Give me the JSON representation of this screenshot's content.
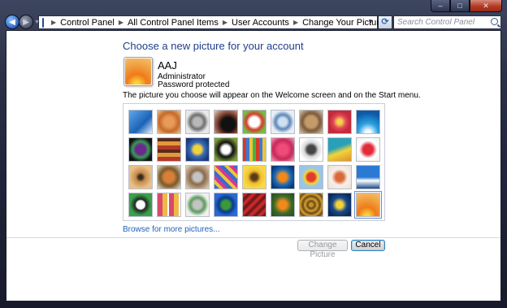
{
  "window": {
    "controls": [
      "–",
      "□",
      "✕"
    ]
  },
  "address_bar": {
    "crumbs": [
      "Control Panel",
      "All Control Panel Items",
      "User Accounts",
      "Change Your Picture"
    ],
    "search_placeholder": "Search Control Panel"
  },
  "page": {
    "heading": "Choose a new picture for your account",
    "account": {
      "name": "AAJ",
      "role": "Administrator",
      "status": "Password protected"
    },
    "description": "The picture you choose will appear on the Welcome screen and on the Start menu.",
    "browse_link": "Browse for more pictures...",
    "buttons": {
      "change": "Change Picture",
      "cancel": "Cancel"
    }
  },
  "pictures": [
    {
      "icon": "ferris-wheel",
      "bg": "linear-gradient(135deg,#5fa8e8,#1c63b7 60%,#e6eef8)"
    },
    {
      "icon": "starfish",
      "bg": "radial-gradient(circle,#e89a58 30%,#c46a2a 60%,#f0c48e)"
    },
    {
      "icon": "robot-toy",
      "bg": "radial-gradient(circle,#b8b8b8 25%,#6e6e6e 45%,#e8e8e8 70%)"
    },
    {
      "icon": "record-player",
      "bg": "radial-gradient(circle at 60% 60%,#111 35%,#7a3a2a 55%,#e1d3c0)"
    },
    {
      "icon": "lucky-cat",
      "bg": "radial-gradient(circle,#fff 30%,#d43a2a 50%,#7ab84a 75%)"
    },
    {
      "icon": "globe",
      "bg": "radial-gradient(circle,#cfe0f0 25%,#5a87b8 45%,#e8eef4 70%)"
    },
    {
      "icon": "cat",
      "bg": "radial-gradient(circle,#c49a6a 35%,#7a5a3a 55%,#d8c8b0)"
    },
    {
      "icon": "flower",
      "bg": "radial-gradient(circle,#f4d24a 15%,#e2455a 40%,#c42a3a 65%)"
    },
    {
      "icon": "ferris-wheel-blue",
      "bg": "radial-gradient(circle at 50% 100%,#ffffff 10%,#2aa0e0 40%,#0e5aa8 80%)"
    },
    {
      "icon": "ball-ornament",
      "bg": "radial-gradient(circle,#6a2a8a 30%,#3a9a5a 50%,#111 75%)"
    },
    {
      "icon": "fabric",
      "bg": "repeating-linear-gradient(0deg,#b23a2a 0 5px,#e09a3a 5px 10px,#5a2a1a 10px 14px)"
    },
    {
      "icon": "leaf",
      "bg": "radial-gradient(circle,#f0d23a 25%,#3a6ab8 45%,#1a3a7a 80%)"
    },
    {
      "icon": "dog",
      "bg": "radial-gradient(circle,#fff 25%,#111 45%,#7a9a3a 80%)"
    },
    {
      "icon": "crayons",
      "bg": "repeating-linear-gradient(90deg,#d43a2a 0 4px,#3a7ad4 4px 8px,#f0c43a 8px 12px,#3ab84a 12px 16px)"
    },
    {
      "icon": "paper-star",
      "bg": "radial-gradient(circle,#f04a7a 30%,#c42a5a 60%,#f8a0b8)"
    },
    {
      "icon": "jacks",
      "bg": "radial-gradient(circle,#444 25%,#d8d8d8 45%,#fff 75%)"
    },
    {
      "icon": "stairs",
      "bg": "linear-gradient(160deg,#2aa0b8 40%,#f0d43a 60%,#e0902a)"
    },
    {
      "icon": "paper-crane",
      "bg": "radial-gradient(circle,#e22a3a 30%,#fff 55%,#f0f0f0)"
    },
    {
      "icon": "guitar",
      "bg": "radial-gradient(circle,#3a2a1a 12%,#c48a4a 30%,#e8c08a 70%)"
    },
    {
      "icon": "puppy",
      "bg": "radial-gradient(circle,#d8803a 30%,#7a5a2a 55%,#e8e0d0)"
    },
    {
      "icon": "toy-robot",
      "bg": "radial-gradient(circle,#c4c4c4 25%,#8a6a4a 45%,#e8d8c0)"
    },
    {
      "icon": "fabric-stripes",
      "bg": "repeating-linear-gradient(45deg,#3a6ad4 0 4px,#f0c43a 4px 8px,#d43a8a 8px 12px)"
    },
    {
      "icon": "sunflower",
      "bg": "radial-gradient(circle,#5a3a1a 18%,#f0c02a 40%,#f8d84a 70%)"
    },
    {
      "icon": "goldfish",
      "bg": "radial-gradient(circle,#f08a1a 25%,#1a6ab8 50%,#0a3a7a 80%)"
    },
    {
      "icon": "hot-air-balloon",
      "bg": "radial-gradient(circle,#e23a2a 25%,#f0d43a 40%,#9ac4e8 60%)"
    },
    {
      "icon": "ornament",
      "bg": "radial-gradient(circle,#d86a3a 25%,#f8f0e8 50%,#e8e0d8)"
    },
    {
      "icon": "sailboat",
      "bg": "linear-gradient(180deg,#2a7ad4 50%,#fff 65%,#1a4a8a)"
    },
    {
      "icon": "soccer-ball",
      "bg": "radial-gradient(circle,#fff 25%,#222 35%,#3aa04a 65%)"
    },
    {
      "icon": "quilt",
      "bg": "repeating-linear-gradient(90deg,#d84a6a 0 6px,#f0b84a 6px 12px,#fff 12px 14px)"
    },
    {
      "icon": "marbles",
      "bg": "radial-gradient(circle,#c4c4c4 25%,#5a9a5a 45%,#f0f0f0 70%)"
    },
    {
      "icon": "window-frame",
      "bg": "radial-gradient(circle,#3a9a3a 25%,#0a3a8a 45%,#2a6ad4 70%)"
    },
    {
      "icon": "red-fabric",
      "bg": "repeating-linear-gradient(135deg,#c42a2a 0 4px,#7a1a1a 4px 8px)"
    },
    {
      "icon": "butterfly",
      "bg": "radial-gradient(circle,#f08a1a 25%,#3a6a2a 55%,#2a4a1a)"
    },
    {
      "icon": "spiral",
      "bg": "repeating-radial-gradient(circle,#c4902a 0 3px,#7a5a1a 3px 6px)"
    },
    {
      "icon": "lantern",
      "bg": "radial-gradient(circle,#f0d43a 20%,#1a4a8a 45%,#0a2a5a 80%)"
    },
    {
      "icon": "gerbera",
      "bg": "radial-gradient(circle at 45% 100%,#f8d43a 8%,#f07a1a 35%,#f0a040 65%,#f8c070)"
    }
  ]
}
